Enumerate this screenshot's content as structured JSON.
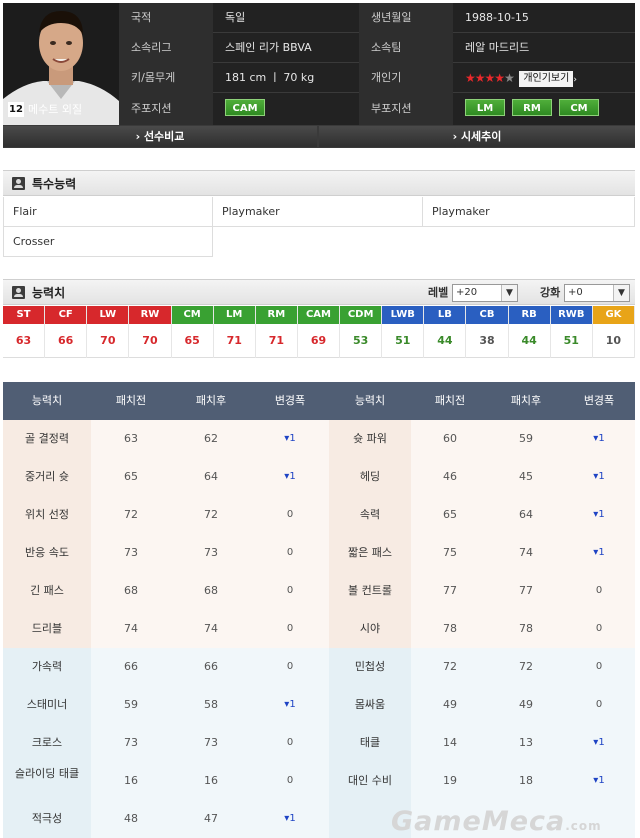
{
  "profile": {
    "back_number": "12",
    "name": "메수트 외질",
    "rows": [
      {
        "label1": "국적",
        "value1": "독일",
        "label2": "생년월일",
        "value2": "1988-10-15"
      },
      {
        "label1": "소속리그",
        "value1": "스페인 리가 BBVA",
        "label2": "소속팀",
        "value2": "레알 마드리드"
      },
      {
        "label1": "키/몸무게",
        "value1": "181 cm ㅣ 70 kg",
        "label2": "개인기",
        "value2": ""
      },
      {
        "label1": "주포지션",
        "value1": "",
        "label2": "부포지션",
        "value2": ""
      }
    ],
    "skill_stars": {
      "filled": 4,
      "total": 5
    },
    "skill_button": "개인기보기",
    "main_positions": [
      "CAM"
    ],
    "sub_positions": [
      "LM",
      "RM",
      "CM"
    ],
    "compare_button": "› 선수비교",
    "trend_button": "› 시세추이"
  },
  "special": {
    "title": "특수능력",
    "traits": [
      "Flair",
      "Playmaker",
      "Playmaker",
      "Crosser"
    ]
  },
  "ability": {
    "title": "능력치",
    "level_label": "레벨",
    "level_value": "+20",
    "enhance_label": "강화",
    "enhance_value": "+0",
    "positions": [
      {
        "name": "ST",
        "value": "63",
        "color": "#d7282c",
        "val_color": "#d7282c"
      },
      {
        "name": "CF",
        "value": "66",
        "color": "#d7282c",
        "val_color": "#d7282c"
      },
      {
        "name": "LW",
        "value": "70",
        "color": "#d7282c",
        "val_color": "#d7282c"
      },
      {
        "name": "RW",
        "value": "70",
        "color": "#d7282c",
        "val_color": "#d7282c"
      },
      {
        "name": "CM",
        "value": "65",
        "color": "#39a132",
        "val_color": "#d7282c"
      },
      {
        "name": "LM",
        "value": "71",
        "color": "#39a132",
        "val_color": "#d7282c"
      },
      {
        "name": "RM",
        "value": "71",
        "color": "#39a132",
        "val_color": "#d7282c"
      },
      {
        "name": "CAM",
        "value": "69",
        "color": "#39a132",
        "val_color": "#d7282c"
      },
      {
        "name": "CDM",
        "value": "53",
        "color": "#39a132",
        "val_color": "#3a8a2a"
      },
      {
        "name": "LWB",
        "value": "51",
        "color": "#2a5fc1",
        "val_color": "#3a8a2a"
      },
      {
        "name": "LB",
        "value": "44",
        "color": "#2a5fc1",
        "val_color": "#3a8a2a"
      },
      {
        "name": "CB",
        "value": "38",
        "color": "#2a5fc1",
        "val_color": "#555555"
      },
      {
        "name": "RB",
        "value": "44",
        "color": "#2a5fc1",
        "val_color": "#3a8a2a"
      },
      {
        "name": "RWB",
        "value": "51",
        "color": "#2a5fc1",
        "val_color": "#3a8a2a"
      },
      {
        "name": "GK",
        "value": "10",
        "color": "#e8a418",
        "val_color": "#555555"
      }
    ]
  },
  "stats": {
    "headers": [
      "능력치",
      "패치전",
      "패치후",
      "변경폭",
      "능력치",
      "패치전",
      "패치후",
      "변경폭"
    ],
    "rows": [
      {
        "n1": "골 결정력",
        "b1": "63",
        "a1": "62",
        "d1": "▾1",
        "n2": "슛 파워",
        "b2": "60",
        "a2": "59",
        "d2": "▾1",
        "group": "red"
      },
      {
        "n1": "중거리 슛",
        "b1": "65",
        "a1": "64",
        "d1": "▾1",
        "n2": "헤딩",
        "b2": "46",
        "a2": "45",
        "d2": "▾1",
        "group": "red"
      },
      {
        "n1": "위치 선정",
        "b1": "72",
        "a1": "72",
        "d1": "0",
        "n2": "속력",
        "b2": "65",
        "a2": "64",
        "d2": "▾1",
        "group": "red"
      },
      {
        "n1": "반응 속도",
        "b1": "73",
        "a1": "73",
        "d1": "0",
        "n2": "짧은 패스",
        "b2": "75",
        "a2": "74",
        "d2": "▾1",
        "group": "red"
      },
      {
        "n1": "긴 패스",
        "b1": "68",
        "a1": "68",
        "d1": "0",
        "n2": "볼 컨트롤",
        "b2": "77",
        "a2": "77",
        "d2": "0",
        "group": "red"
      },
      {
        "n1": "드리블",
        "b1": "74",
        "a1": "74",
        "d1": "0",
        "n2": "시야",
        "b2": "78",
        "a2": "78",
        "d2": "0",
        "group": "red"
      },
      {
        "n1": "가속력",
        "b1": "66",
        "a1": "66",
        "d1": "0",
        "n2": "민첩성",
        "b2": "72",
        "a2": "72",
        "d2": "0",
        "group": "blue"
      },
      {
        "n1": "스태미너",
        "b1": "59",
        "a1": "58",
        "d1": "▾1",
        "n2": "몸싸움",
        "b2": "49",
        "a2": "49",
        "d2": "0",
        "group": "blue"
      },
      {
        "n1": "크로스",
        "b1": "73",
        "a1": "73",
        "d1": "0",
        "n2": "태클",
        "b2": "14",
        "a2": "13",
        "d2": "▾1",
        "group": "blue"
      },
      {
        "n1": "슬라이딩 태클",
        "b1": "16",
        "a1": "16",
        "d1": "0",
        "n2": "대인 수비",
        "b2": "19",
        "a2": "18",
        "d2": "▾1",
        "group": "blue"
      },
      {
        "n1": "적극성",
        "b1": "48",
        "a1": "47",
        "d1": "▾1",
        "n2": "",
        "b2": "",
        "a2": "",
        "d2": "",
        "group": "blue"
      }
    ]
  },
  "watermark": {
    "text": "GameMeca",
    "suffix": ".com"
  }
}
